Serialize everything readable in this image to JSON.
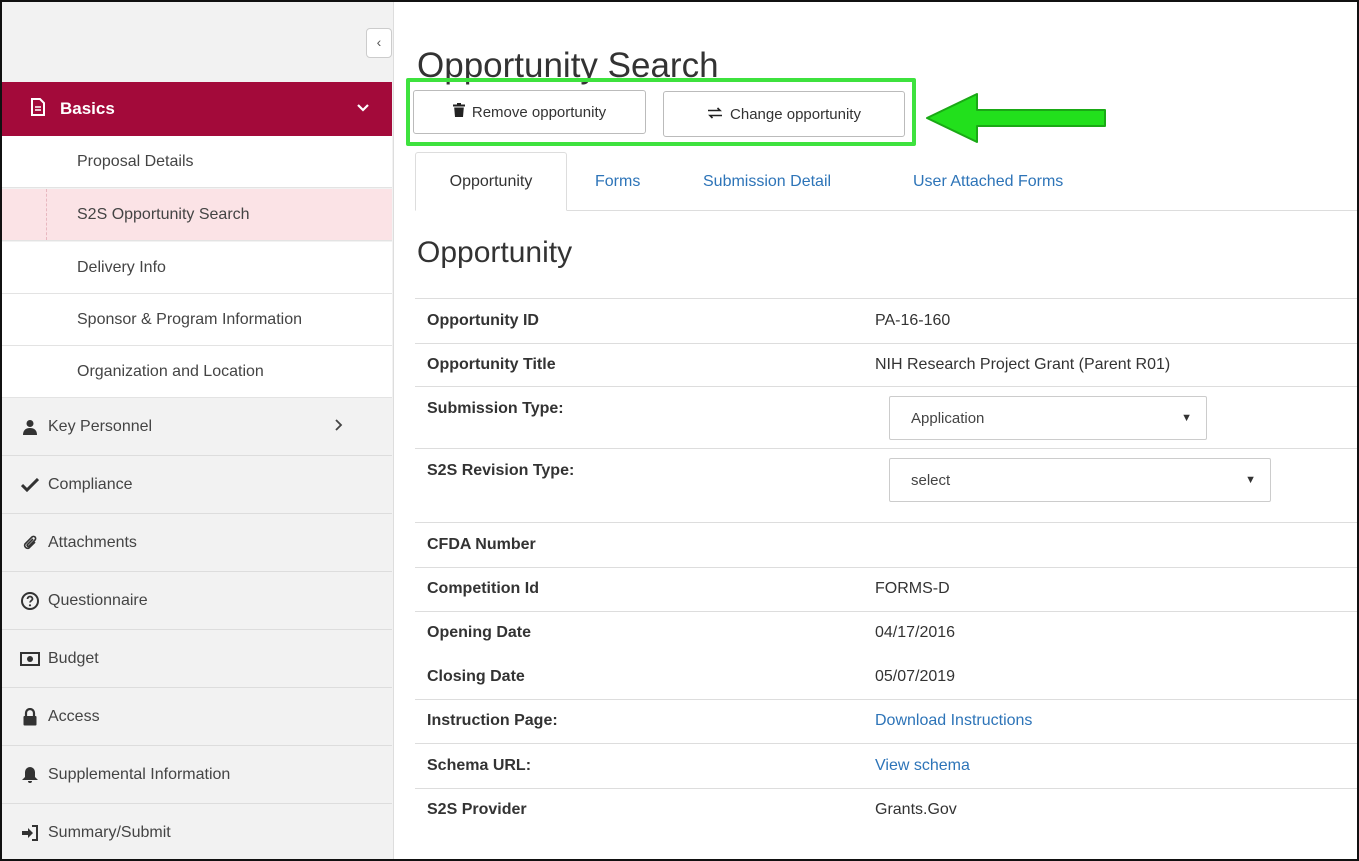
{
  "sidebar": {
    "collapse_glyph": "‹",
    "basics": {
      "label": "Basics",
      "icon": "document-icon",
      "chevron": "chevron-down-icon"
    },
    "sub_items": [
      {
        "label": "Proposal Details"
      },
      {
        "label": "S2S Opportunity Search",
        "active": true
      },
      {
        "label": "Delivery Info"
      },
      {
        "label": "Sponsor & Program Information"
      },
      {
        "label": "Organization and Location"
      }
    ],
    "items": [
      {
        "label": "Key Personnel",
        "icon": "user-icon"
      },
      {
        "label": "Compliance",
        "icon": "checkmark-icon"
      },
      {
        "label": "Attachments",
        "icon": "paperclip-icon"
      },
      {
        "label": "Questionnaire",
        "icon": "question-circle-icon"
      },
      {
        "label": "Budget",
        "icon": "money-icon"
      },
      {
        "label": "Access",
        "icon": "lock-icon"
      },
      {
        "label": "Supplemental Information",
        "icon": "bell-icon"
      },
      {
        "label": "Summary/Submit",
        "icon": "sign-in-icon"
      }
    ]
  },
  "header": {
    "title": "Opportunity Search",
    "remove_label": "Remove opportunity",
    "change_label": "Change opportunity"
  },
  "tabs": [
    {
      "label": "Opportunity",
      "active": true
    },
    {
      "label": "Forms"
    },
    {
      "label": "Submission Detail"
    },
    {
      "label": "User Attached Forms"
    }
  ],
  "section": {
    "title": "Opportunity",
    "rows": [
      {
        "label": "Opportunity ID",
        "value": "PA-16-160"
      },
      {
        "label": "Opportunity Title",
        "value": "NIH Research Project Grant (Parent R01)"
      },
      {
        "label": "Submission Type:",
        "value": "Application"
      },
      {
        "label": "S2S Revision Type:",
        "value": "select"
      },
      {
        "label": "CFDA Number",
        "value": ""
      },
      {
        "label": "Competition Id",
        "value": "FORMS-D"
      },
      {
        "label": "Opening Date",
        "value": "04/17/2016"
      },
      {
        "label": "Closing Date",
        "value": "05/07/2019"
      },
      {
        "label": "Instruction Page:",
        "value": "Download Instructions"
      },
      {
        "label": "Schema URL:",
        "value": "View schema"
      },
      {
        "label": "S2S Provider",
        "value": "Grants.Gov"
      }
    ]
  },
  "colors": {
    "brand": "#a30a3a",
    "active_sub_bg": "#fbe3e6",
    "link": "#2d74b8",
    "highlight": "#3ee23e"
  }
}
